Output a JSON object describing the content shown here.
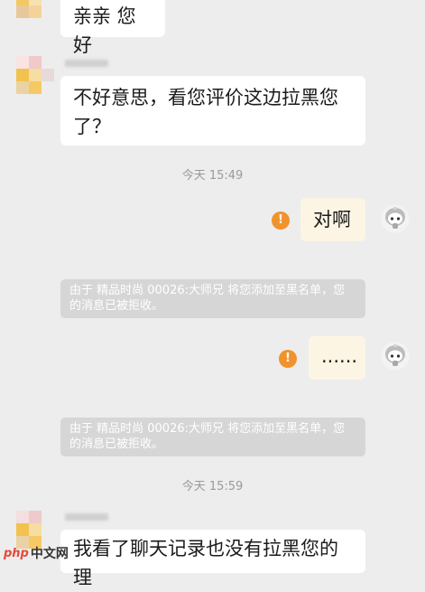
{
  "messages": {
    "greeting": "亲亲 您好",
    "apology": "不好意思，看您评价这边拉黑您了？",
    "reply_yes": "对啊",
    "reply_dots": "......",
    "last_message": "我看了聊天记录也没有拉黑您的理"
  },
  "timestamps": {
    "first": "今天 15:49",
    "second": "今天 15:59"
  },
  "system_notes": {
    "blocked_1": "由于 精品时尚 00026:大师兄 将您添加至黑名单，您的消息已被拒收。",
    "blocked_2": "由于 精品时尚 00026:大师兄 将您添加至黑名单，您的消息已被拒收。"
  },
  "icons": {
    "failed": "!",
    "failed_color": "#f0932d"
  },
  "watermark": {
    "php": "php",
    "site": "中文网"
  },
  "colors": {
    "background": "#ededed",
    "left_bubble": "#ffffff",
    "right_bubble": "#fdf5e4",
    "system_note": "#d6d6d6"
  }
}
